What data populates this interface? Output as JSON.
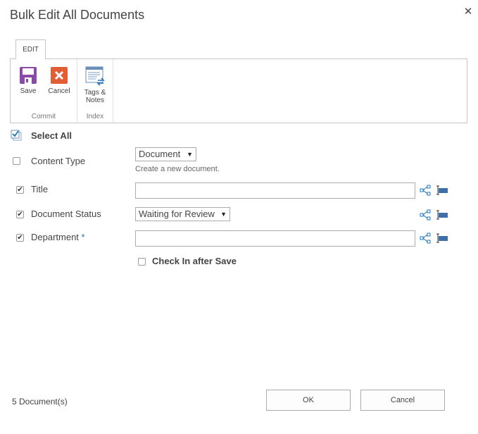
{
  "dialog": {
    "title": "Bulk Edit All Documents",
    "close": "✕"
  },
  "ribbon": {
    "tab": "EDIT",
    "buttons": {
      "save": "Save",
      "cancel": "Cancel",
      "tags_line1": "Tags &",
      "tags_line2": "Notes"
    },
    "groups": {
      "commit": "Commit",
      "index": "Index"
    }
  },
  "form": {
    "select_all": "Select All",
    "content_type": {
      "label": "Content Type",
      "value": "Document",
      "hint": "Create a new document."
    },
    "title": {
      "label": "Title",
      "value": ""
    },
    "document_status": {
      "label": "Document Status",
      "value": "Waiting for Review"
    },
    "department": {
      "label": "Department",
      "required_mark": "*",
      "value": ""
    },
    "check_in": "Check In after Save"
  },
  "checkmark": "✔",
  "dropdown_arrow": "▼",
  "footer": {
    "count": "5  Document(s)",
    "ok": "OK",
    "cancel": "Cancel"
  },
  "colors": {
    "accent": "#1b75bb",
    "save_purple": "#8a4aa5",
    "cancel_orange": "#e25e35"
  }
}
